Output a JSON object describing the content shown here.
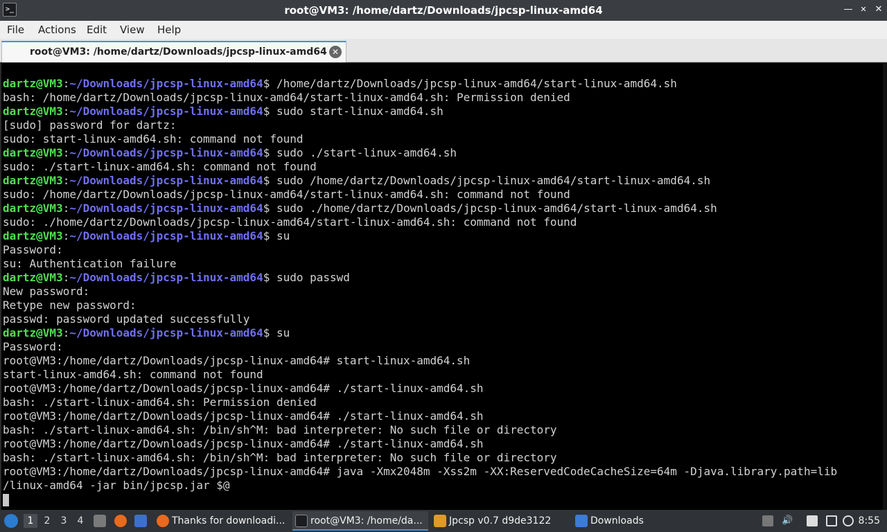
{
  "window": {
    "title": "root@VM3: /home/dartz/Downloads/jpcsp-linux-amd64",
    "app_icon": ">_",
    "minimize_glyph": "—",
    "maximize_glyph": "✕",
    "close_glyph": "✕"
  },
  "menu": {
    "file": "File",
    "actions": "Actions",
    "edit": "Edit",
    "view": "View",
    "help": "Help"
  },
  "tab": {
    "label": "root@VM3: /home/dartz/Downloads/jpcsp-linux-amd64",
    "close_glyph": "✕"
  },
  "terminal": {
    "lines": [
      {
        "user": "dartz@VM3",
        "sep": ":",
        "path": "~/Downloads/jpcsp-linux-amd64",
        "cmd": "$ /home/dartz/Downloads/jpcsp-linux-amd64/start-linux-amd64.sh"
      },
      {
        "text": "bash: /home/dartz/Downloads/jpcsp-linux-amd64/start-linux-amd64.sh: Permission denied"
      },
      {
        "user": "dartz@VM3",
        "sep": ":",
        "path": "~/Downloads/jpcsp-linux-amd64",
        "cmd": "$ sudo start-linux-amd64.sh"
      },
      {
        "text": "[sudo] password for dartz:"
      },
      {
        "text": "sudo: start-linux-amd64.sh: command not found"
      },
      {
        "user": "dartz@VM3",
        "sep": ":",
        "path": "~/Downloads/jpcsp-linux-amd64",
        "cmd": "$ sudo ./start-linux-amd64.sh"
      },
      {
        "text": "sudo: ./start-linux-amd64.sh: command not found"
      },
      {
        "user": "dartz@VM3",
        "sep": ":",
        "path": "~/Downloads/jpcsp-linux-amd64",
        "cmd": "$ sudo /home/dartz/Downloads/jpcsp-linux-amd64/start-linux-amd64.sh"
      },
      {
        "text": "sudo: /home/dartz/Downloads/jpcsp-linux-amd64/start-linux-amd64.sh: command not found"
      },
      {
        "user": "dartz@VM3",
        "sep": ":",
        "path": "~/Downloads/jpcsp-linux-amd64",
        "cmd": "$ sudo ./home/dartz/Downloads/jpcsp-linux-amd64/start-linux-amd64.sh"
      },
      {
        "text": "sudo: ./home/dartz/Downloads/jpcsp-linux-amd64/start-linux-amd64.sh: command not found"
      },
      {
        "user": "dartz@VM3",
        "sep": ":",
        "path": "~/Downloads/jpcsp-linux-amd64",
        "cmd": "$ su"
      },
      {
        "text": "Password:"
      },
      {
        "text": "su: Authentication failure"
      },
      {
        "user": "dartz@VM3",
        "sep": ":",
        "path": "~/Downloads/jpcsp-linux-amd64",
        "cmd": "$ sudo passwd"
      },
      {
        "text": "New password:"
      },
      {
        "text": "Retype new password:"
      },
      {
        "text": "passwd: password updated successfully"
      },
      {
        "user": "dartz@VM3",
        "sep": ":",
        "path": "~/Downloads/jpcsp-linux-amd64",
        "cmd": "$ su"
      },
      {
        "text": "Password:"
      },
      {
        "text": "root@VM3:/home/dartz/Downloads/jpcsp-linux-amd64# start-linux-amd64.sh"
      },
      {
        "text": "start-linux-amd64.sh: command not found"
      },
      {
        "text": "root@VM3:/home/dartz/Downloads/jpcsp-linux-amd64# ./start-linux-amd64.sh"
      },
      {
        "text": "bash: ./start-linux-amd64.sh: Permission denied"
      },
      {
        "text": "root@VM3:/home/dartz/Downloads/jpcsp-linux-amd64# ./start-linux-amd64.sh"
      },
      {
        "text": "bash: ./start-linux-amd64.sh: /bin/sh^M: bad interpreter: No such file or directory"
      },
      {
        "text": "root@VM3:/home/dartz/Downloads/jpcsp-linux-amd64# ./start-linux-amd64.sh"
      },
      {
        "text": "bash: ./start-linux-amd64.sh: /bin/sh^M: bad interpreter: No such file or directory"
      },
      {
        "text": "root@VM3:/home/dartz/Downloads/jpcsp-linux-amd64# java -Xmx2048m -Xss2m -XX:ReservedCodeCacheSize=64m -Djava.library.path=lib"
      },
      {
        "text": "/linux-amd64 -jar bin/jpcsp.jar $@"
      }
    ],
    "colors": {
      "user": "#4fe04f",
      "path": "#6f6ff0",
      "text": "#d2d2d2",
      "background": "#000000"
    }
  },
  "taskbar": {
    "workspaces": [
      "1",
      "2",
      "3",
      "4"
    ],
    "active_workspace": "1",
    "tasks": [
      {
        "label": "Thanks for downloadi...",
        "icon": "firefox-icon"
      },
      {
        "label": "root@VM3: /home/da...",
        "icon": "terminal-icon",
        "active": true
      },
      {
        "label": "Jpcsp v0.7 d9de3122",
        "icon": "java-icon"
      },
      {
        "label": "Downloads",
        "icon": "folder-icon"
      }
    ],
    "clock": "8:55"
  }
}
